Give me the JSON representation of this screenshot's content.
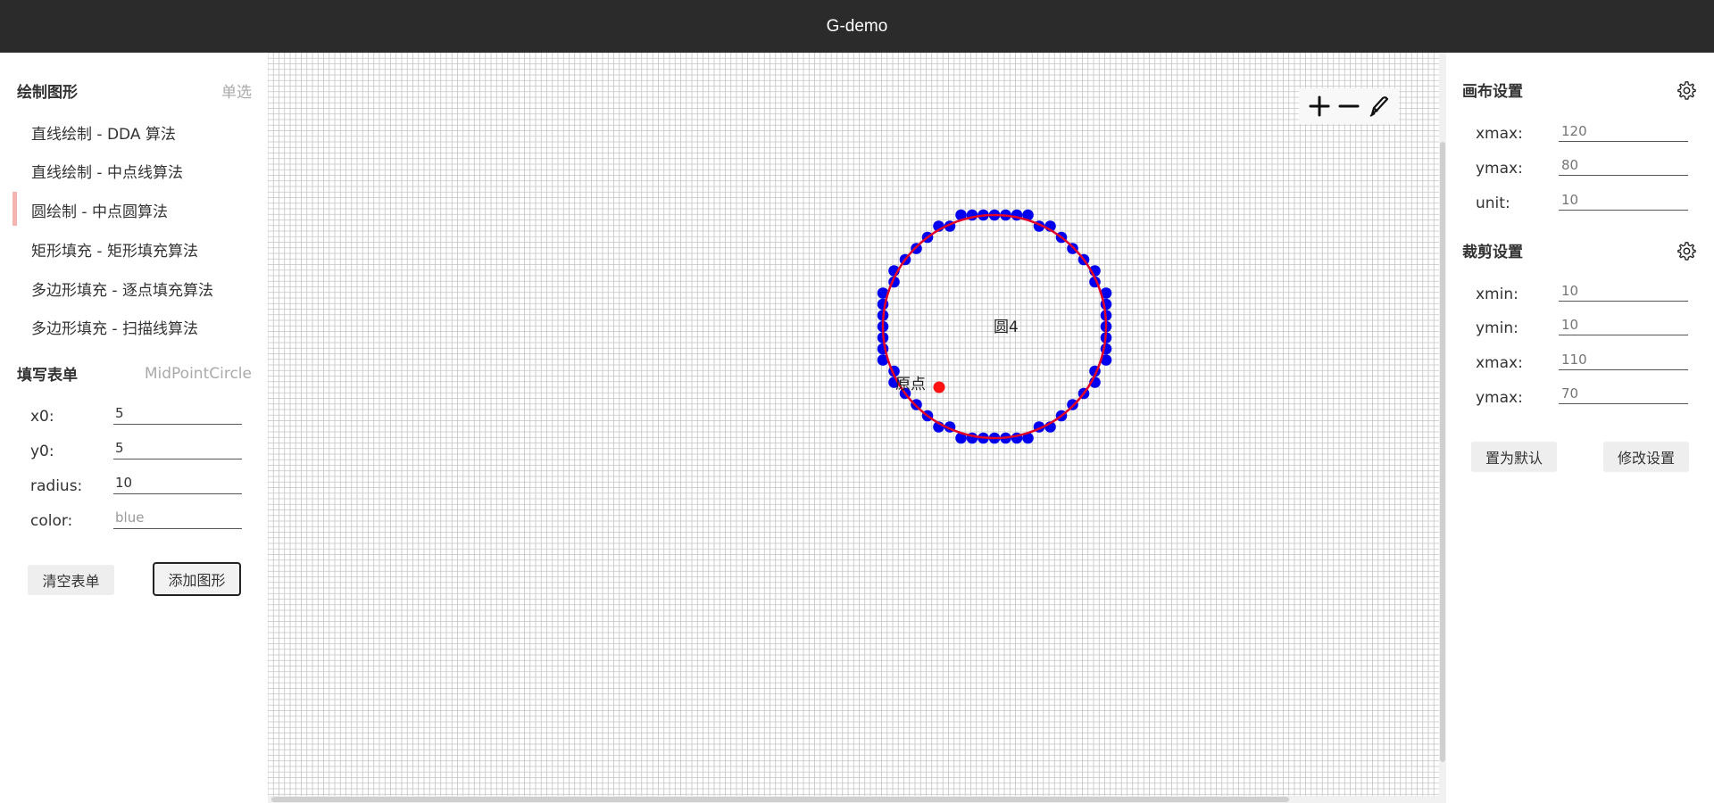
{
  "app": {
    "title": "G-demo"
  },
  "left": {
    "draw_section": {
      "title": "绘制图形",
      "mode": "单选"
    },
    "menu": [
      {
        "label": "直线绘制 - DDA 算法",
        "active": false
      },
      {
        "label": "直线绘制 - 中点线算法",
        "active": false
      },
      {
        "label": "圆绘制 - 中点圆算法",
        "active": true
      },
      {
        "label": "矩形填充 - 矩形填充算法",
        "active": false
      },
      {
        "label": "多边形填充 - 逐点填充算法",
        "active": false
      },
      {
        "label": "多边形填充 - 扫描线算法",
        "active": false
      }
    ],
    "form_section": {
      "title": "填写表单",
      "algorithm": "MidPointCircle"
    },
    "form": {
      "x0": {
        "label": "x0:",
        "value": "5"
      },
      "y0": {
        "label": "y0:",
        "value": "5"
      },
      "radius": {
        "label": "radius:",
        "value": "10"
      },
      "color": {
        "label": "color:",
        "placeholder": "blue"
      }
    },
    "buttons": {
      "clear": "清空表单",
      "add": "添加图形"
    }
  },
  "canvas": {
    "toolbar": {
      "zoom_in": "plus-icon",
      "zoom_out": "minus-icon",
      "edit": "pen-icon"
    },
    "shape": {
      "label": "圆4",
      "origin_label": "原点"
    },
    "colors": {
      "grid": "#c4c4c4",
      "pixel": "#0000ee",
      "ideal_circle": "#e0002a",
      "origin": "#ff1111"
    }
  },
  "right": {
    "canvas_settings": {
      "title": "画布设置",
      "fields": [
        {
          "label": "xmax:",
          "placeholder": "120"
        },
        {
          "label": "ymax:",
          "placeholder": "80"
        },
        {
          "label": "unit:",
          "placeholder": "10"
        }
      ]
    },
    "clip_settings": {
      "title": "裁剪设置",
      "fields": [
        {
          "label": "xmin:",
          "placeholder": "10"
        },
        {
          "label": "ymin:",
          "placeholder": "10"
        },
        {
          "label": "xmax:",
          "placeholder": "110"
        },
        {
          "label": "ymax:",
          "placeholder": "70"
        }
      ]
    },
    "buttons": {
      "reset": "置为默认",
      "apply": "修改设置"
    }
  }
}
